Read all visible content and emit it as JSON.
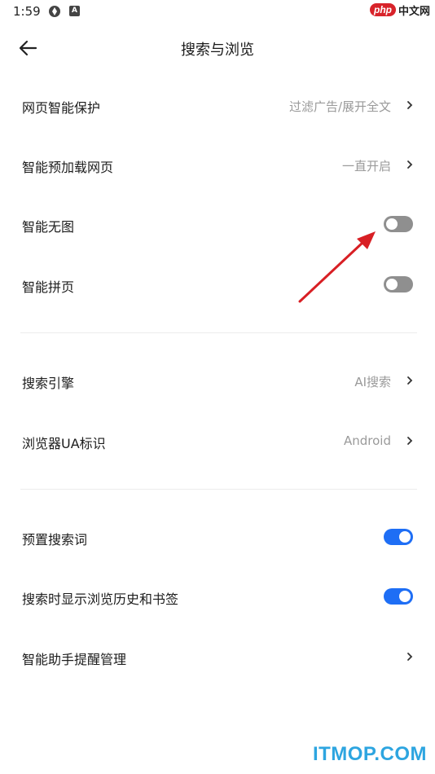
{
  "status_bar": {
    "time": "1:59"
  },
  "watermark_top": {
    "php": "php",
    "cn": "中文网"
  },
  "header": {
    "title": "搜索与浏览"
  },
  "rows": [
    {
      "label": "网页智能保护",
      "value": "过滤广告/展开全文"
    },
    {
      "label": "智能预加载网页",
      "value": "一直开启"
    },
    {
      "label": "智能无图",
      "toggle": "off"
    },
    {
      "label": "智能拼页",
      "toggle": "off"
    },
    {
      "label": "搜索引擎",
      "value": "AI搜索"
    },
    {
      "label": "浏览器UA标识",
      "value": "Android"
    },
    {
      "label": "预置搜索词",
      "toggle": "on"
    },
    {
      "label": "搜索时显示浏览历史和书签",
      "toggle": "on"
    },
    {
      "label": "智能助手提醒管理"
    }
  ],
  "colors": {
    "accent": "#1e6ef5",
    "toggle_off": "#8f8f8f",
    "annotation_arrow": "#d81f24",
    "watermark": "#2da5e0"
  },
  "watermark_bottom": "ITMOP.COM"
}
